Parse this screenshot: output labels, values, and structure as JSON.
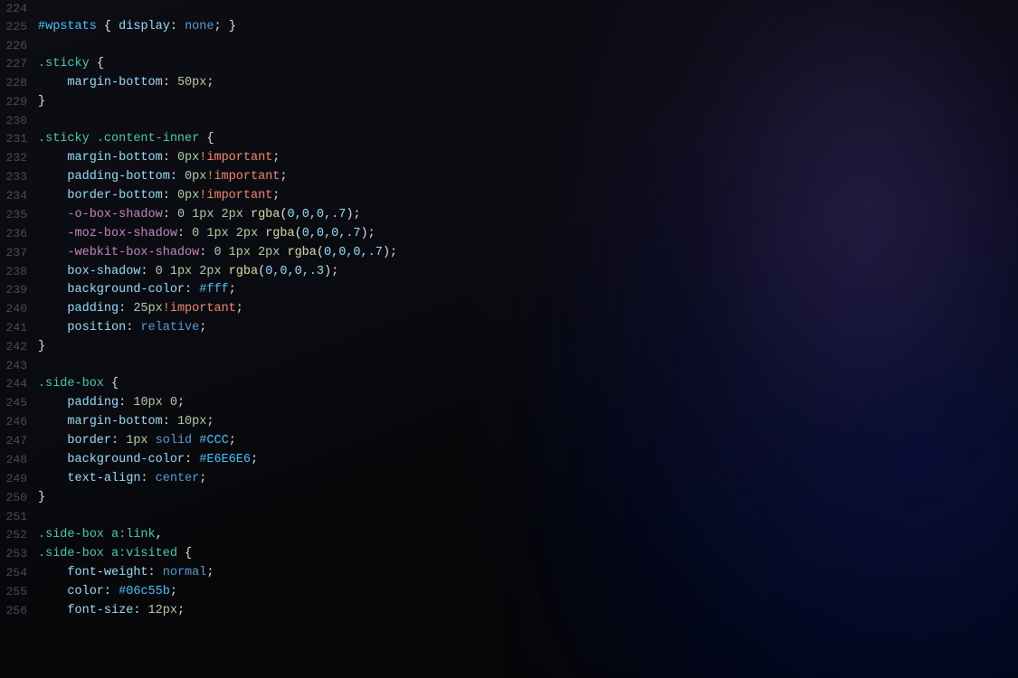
{
  "editor": {
    "lines": [
      {
        "num": "224",
        "parts": []
      },
      {
        "num": "225",
        "content": "#wpstats { display: none; }"
      },
      {
        "num": "226",
        "parts": []
      },
      {
        "num": "227",
        "content": ".sticky {"
      },
      {
        "num": "228",
        "content": "    margin-bottom: 50px;"
      },
      {
        "num": "229",
        "content": "}"
      },
      {
        "num": "230",
        "parts": []
      },
      {
        "num": "231",
        "content": ".sticky .content-inner {"
      },
      {
        "num": "232",
        "content": "    margin-bottom: 0px!important;"
      },
      {
        "num": "233",
        "content": "    padding-bottom: 0px!important;"
      },
      {
        "num": "234",
        "content": "    border-bottom: 0px!important;"
      },
      {
        "num": "235",
        "content": "    -o-box-shadow: 0 1px 2px rgba(0,0,0,.7);"
      },
      {
        "num": "236",
        "content": "    -moz-box-shadow: 0 1px 2px rgba(0,0,0,.7);"
      },
      {
        "num": "237",
        "content": "    -webkit-box-shadow: 0 1px 2px rgba(0,0,0,.7);"
      },
      {
        "num": "238",
        "content": "    box-shadow: 0 1px 2px rgba(0,0,0,.3);"
      },
      {
        "num": "239",
        "content": "    background-color: #fff;"
      },
      {
        "num": "240",
        "content": "    padding: 25px!important;"
      },
      {
        "num": "241",
        "content": "    position: relative;"
      },
      {
        "num": "242",
        "content": "}"
      },
      {
        "num": "243",
        "parts": []
      },
      {
        "num": "244",
        "content": ".side-box {"
      },
      {
        "num": "245",
        "content": "    padding: 10px 0;"
      },
      {
        "num": "246",
        "content": "    margin-bottom: 10px;"
      },
      {
        "num": "247",
        "content": "    border: 1px solid #CCC;"
      },
      {
        "num": "248",
        "content": "    background-color: #E6E6E6;"
      },
      {
        "num": "249",
        "content": "    text-align: center;"
      },
      {
        "num": "250",
        "content": "}"
      },
      {
        "num": "251",
        "parts": []
      },
      {
        "num": "252",
        "content": ".side-box a:link,"
      },
      {
        "num": "253",
        "content": ".side-box a:visited {"
      },
      {
        "num": "254",
        "content": "    font-weight: normal;"
      },
      {
        "num": "255",
        "content": "    color: #06c55b;"
      },
      {
        "num": "256",
        "content": "    font-size: 12px;"
      }
    ]
  }
}
